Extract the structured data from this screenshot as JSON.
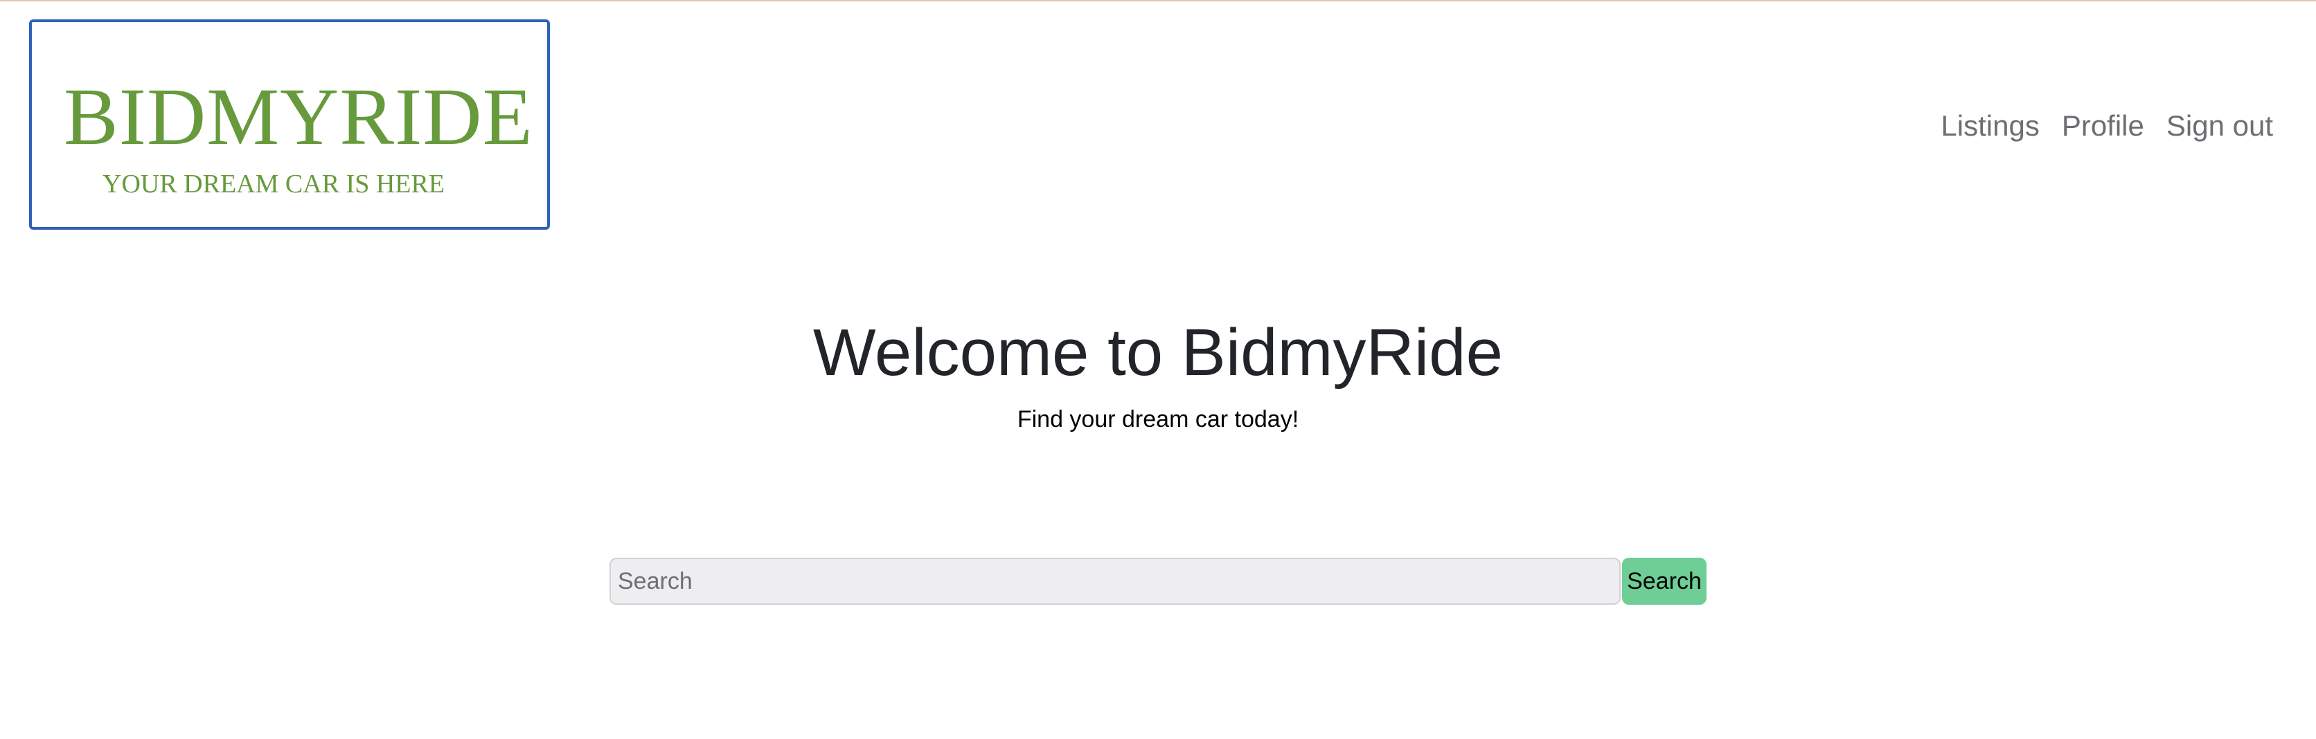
{
  "logo": {
    "title": "BIDMYRIDE",
    "tagline": "YOUR DREAM CAR IS HERE",
    "text_color": "#669a3c",
    "border_color": "#2f62b9"
  },
  "nav": {
    "items": [
      {
        "label": "Listings"
      },
      {
        "label": "Profile"
      },
      {
        "label": "Sign out"
      }
    ]
  },
  "hero": {
    "title": "Welcome to BidmyRide",
    "subtitle": "Find your dream car today!"
  },
  "search": {
    "placeholder": "Search",
    "value": "",
    "button_label": "Search",
    "button_color": "#6fcd96"
  }
}
